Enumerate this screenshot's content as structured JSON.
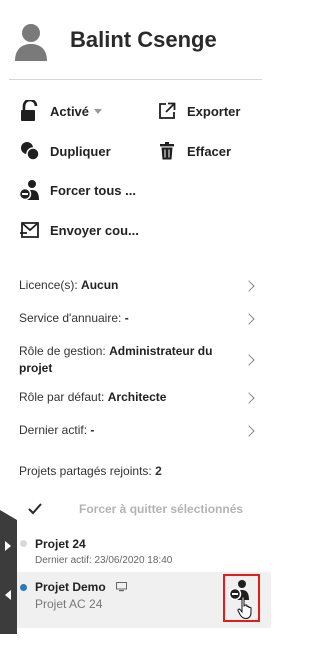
{
  "header": {
    "user_name": "Balint Csenge",
    "avatar_icon": "user-avatar-icon"
  },
  "actions": {
    "status_label": "Activé",
    "export_label": "Exporter",
    "duplicate_label": "Dupliquer",
    "delete_label": "Effacer",
    "force_all_label": "Forcer tous ...",
    "send_label": "Envoyer cou..."
  },
  "details": {
    "license_label": "Licence(s):",
    "license_value": "Aucun",
    "directory_label": "Service d'annuaire:",
    "directory_value": "-",
    "mgmt_role_label": "Rôle de gestion:",
    "mgmt_role_value": "Administrateur du projet",
    "default_role_label": "Rôle par défaut:",
    "default_role_value": "Architecte",
    "last_active_label": "Dernier actif:",
    "last_active_value": "-"
  },
  "shared": {
    "label": "Projets partagés rejoints:",
    "count": "2",
    "force_quit_label": "Forcer à quitter sélectionnés"
  },
  "projects": [
    {
      "name": "Projet 24",
      "subtitle": "Dernier actif: 23/06/2020 18:40",
      "status_color": "#d9d9d9"
    },
    {
      "name": "Projet Demo",
      "subtitle": "Projet AC 24",
      "status_color": "#2b7bb9",
      "badge_icon": "monitor-icon"
    }
  ],
  "colors": {
    "highlight": "#e31c1c",
    "strip": "#3c3c3c"
  }
}
